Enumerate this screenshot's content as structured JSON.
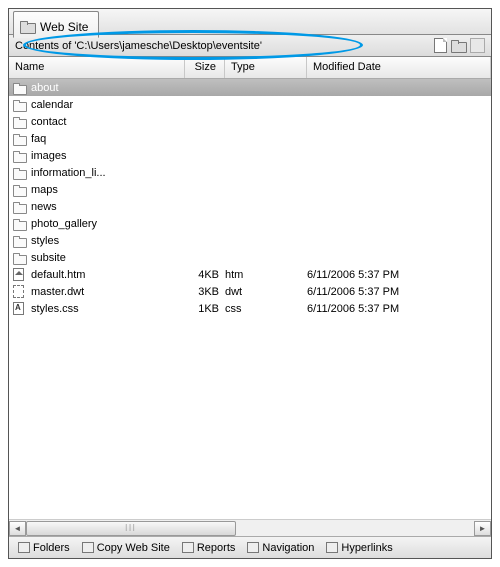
{
  "tab_title": "Web Site",
  "path_bar_text": "Contents of 'C:\\Users\\jamesche\\Desktop\\eventsite'",
  "columns": {
    "name": "Name",
    "size": "Size",
    "type": "Type",
    "date": "Modified Date"
  },
  "folders": [
    "about",
    "calendar",
    "contact",
    "faq",
    "images",
    "information_li...",
    "maps",
    "news",
    "photo_gallery",
    "styles",
    "subsite"
  ],
  "files": [
    {
      "name": "default.htm",
      "size": "4KB",
      "type": "htm",
      "date": "6/11/2006 5:37 PM",
      "icon": "home"
    },
    {
      "name": "master.dwt",
      "size": "3KB",
      "type": "dwt",
      "date": "6/11/2006 5:37 PM",
      "icon": "dwt"
    },
    {
      "name": "styles.css",
      "size": "1KB",
      "type": "css",
      "date": "6/11/2006 5:37 PM",
      "icon": "css"
    }
  ],
  "bottom_tabs": {
    "folders": "Folders",
    "copy_web_site": "Copy Web Site",
    "reports": "Reports",
    "navigation": "Navigation",
    "hyperlinks": "Hyperlinks"
  },
  "selected_folder_index": 0
}
